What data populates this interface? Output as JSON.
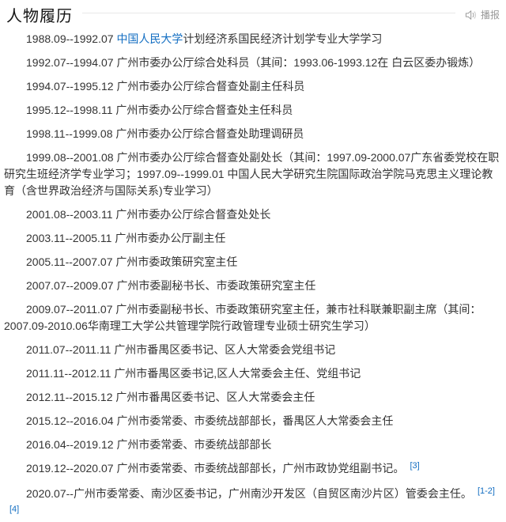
{
  "section": {
    "title": "人物履历",
    "broadcast_label": "播报",
    "broadcast_icon": "speaker-icon"
  },
  "colors": {
    "link_blue": "#136ec2",
    "body_text": "#333333",
    "muted_gray": "#999999",
    "divider": "#e8e8e8"
  },
  "entries": [
    {
      "period": "1988.09--1992.07 ",
      "link": "中国人民大学",
      "text": "计划经济系国民经济计划学专业大学学习",
      "refs": []
    },
    {
      "period": "1992.07--1994.07 ",
      "link": null,
      "text": "广州市委办公厅综合处科员（其间：1993.06-1993.12在 白云区委办锻炼）",
      "refs": []
    },
    {
      "period": "1994.07--1995.12 ",
      "link": null,
      "text": "广州市委办公厅综合督查处副主任科员",
      "refs": []
    },
    {
      "period": "1995.12--1998.11 ",
      "link": null,
      "text": "广州市委办公厅综合督查处主任科员",
      "refs": []
    },
    {
      "period": "1998.11--1999.08 ",
      "link": null,
      "text": "广州市委办公厅综合督查处助理调研员",
      "refs": []
    },
    {
      "period": "1999.08--2001.08 ",
      "link": null,
      "text": "广州市委办公厅综合督查处副处长（其间：1997.09-2000.07广东省委党校在职研究生班经济学专业学习；1997.09--1999.01 中国人民大学研究生院国际政治学院马克思主义理论教育（含世界政治经济与国际关系)专业学习）",
      "refs": []
    },
    {
      "period": "2001.08--2003.11 ",
      "link": null,
      "text": "广州市委办公厅综合督查处处长",
      "refs": []
    },
    {
      "period": "2003.11--2005.11 ",
      "link": null,
      "text": "广州市委办公厅副主任",
      "refs": []
    },
    {
      "period": "2005.11--2007.07 ",
      "link": null,
      "text": "广州市委政策研究室主任",
      "refs": []
    },
    {
      "period": "2007.07--2009.07 ",
      "link": null,
      "text": "广州市委副秘书长、市委政策研究室主任",
      "refs": []
    },
    {
      "period": "2009.07--2011.07 ",
      "link": null,
      "text": "广州市委副秘书长、市委政策研究室主任，兼市社科联兼职副主席（其间：2007.09-2010.06华南理工大学公共管理学院行政管理专业硕士研究生学习）",
      "refs": []
    },
    {
      "period": "2011.07--2011.11 ",
      "link": null,
      "text": "广州市番禺区委书记、区人大常委会党组书记",
      "refs": []
    },
    {
      "period": "2011.11--2012.11 ",
      "link": null,
      "text": "广州市番禺区委书记,区人大常委会主任、党组书记",
      "refs": []
    },
    {
      "period": "2012.11--2015.12 ",
      "link": null,
      "text": "广州市番禺区委书记、区人大常委会主任",
      "refs": []
    },
    {
      "period": "2015.12--2016.04 ",
      "link": null,
      "text": "广州市委常委、市委统战部部长，番禺区人大常委会主任",
      "refs": []
    },
    {
      "period": "2016.04--2019.12 ",
      "link": null,
      "text": "广州市委常委、市委统战部部长",
      "refs": []
    },
    {
      "period": "2019.12--2020.07 ",
      "link": null,
      "text": "广州市委常委、市委统战部部长，广州市政协党组副书记。",
      "refs": [
        "[3]"
      ]
    },
    {
      "period": "2020.07--",
      "link": null,
      "text": "广州市委常委、南沙区委书记，广州南沙开发区（自贸区南沙片区）管委会主任。",
      "refs": [
        "[1-2]",
        "[4]"
      ]
    }
  ]
}
